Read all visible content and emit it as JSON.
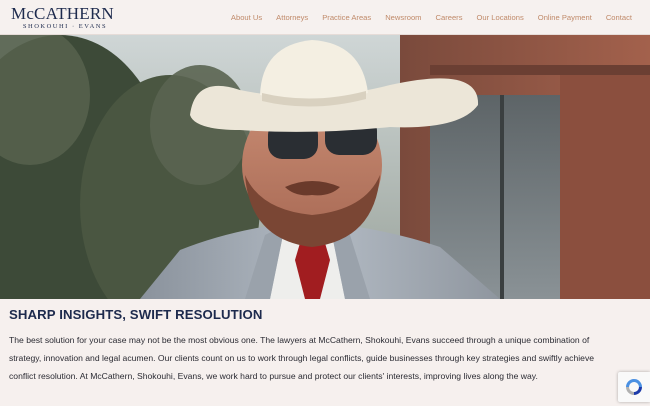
{
  "header": {
    "logo_main": "McCATHERN",
    "logo_sub": "SHOKOUHI · EVANS",
    "nav": [
      "About Us",
      "Attorneys",
      "Practice Areas",
      "Newsroom",
      "Careers",
      "Our Locations",
      "Online Payment",
      "Contact"
    ]
  },
  "hero": {
    "icon": "hero-photo-man-cowboy-hat"
  },
  "main": {
    "headline": "SHARP INSIGHTS, SWIFT RESOLUTION",
    "paragraph": "The best solution for your case may not be the most obvious one. The lawyers at McCathern, Shokouhi, Evans succeed through a unique combination of strategy, innovation and legal acumen. Our clients count on us to work through legal conflicts, guide businesses through key strategies and swiftly achieve conflict resolution. At McCathern, Shokouhi, Evans, we work hard to pursue and protect our clients' interests, improving lives along the way."
  },
  "colors": {
    "brand_navy": "#1d2a4d",
    "nav_accent": "#c08a6a",
    "background": "#f6f0ee"
  }
}
